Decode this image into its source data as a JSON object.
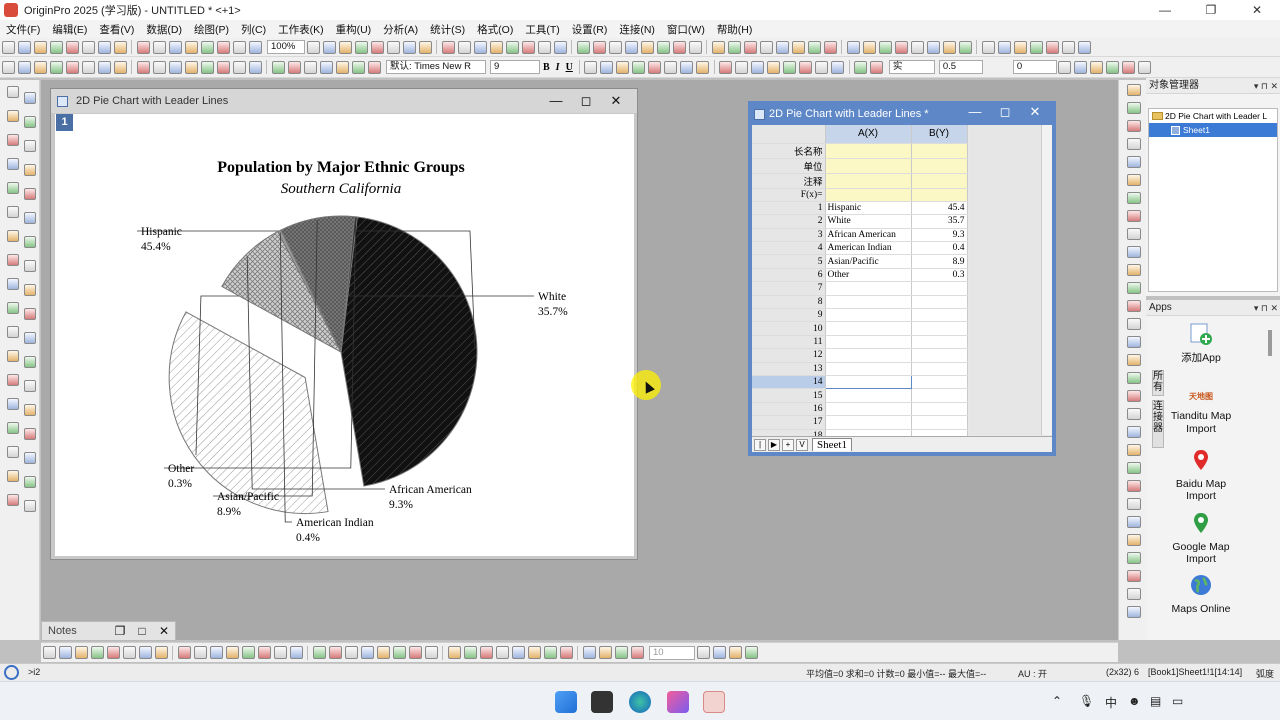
{
  "app": {
    "window_title": "OriginPro 2025 (学习版) - UNTITLED * <+1>",
    "win_buttons": [
      "—",
      "❐",
      "✕"
    ]
  },
  "menu": [
    "文件(F)",
    "编辑(E)",
    "查看(V)",
    "数据(D)",
    "绘图(P)",
    "列(C)",
    "工作表(K)",
    "重构(U)",
    "分析(A)",
    "统计(S)",
    "格式(O)",
    "工具(T)",
    "设置(R)",
    "连接(N)",
    "窗口(W)",
    "帮助(H)"
  ],
  "toolbar": {
    "zoom": "100%",
    "font_name": "默认: Times New R",
    "font_size": "9",
    "bold": "B",
    "italic": "I",
    "underline": "U",
    "line_style": "实",
    "line_width": "0.5",
    "angle": "0",
    "bottom_size": "10"
  },
  "graph_window": {
    "title": "2D Pie Chart with Leader Lines",
    "layer_label": "1"
  },
  "chart_data": {
    "type": "pie",
    "title": "Population by Major Ethnic Groups",
    "subtitle": "Southern California",
    "slices": [
      {
        "label": "Hispanic",
        "value": 45.4,
        "pct_label": "45.4%",
        "fill": "#111111",
        "exploded": false
      },
      {
        "label": "White",
        "value": 35.7,
        "pct_label": "35.7%",
        "fill": "#ffffff",
        "exploded": true
      },
      {
        "label": "African American",
        "value": 9.3,
        "pct_label": "9.3%",
        "fill": "#c8c8c8",
        "exploded": false
      },
      {
        "label": "American Indian",
        "value": 0.4,
        "pct_label": "0.4%",
        "fill": "#9a9a9a",
        "exploded": false
      },
      {
        "label": "Asian/Pacific",
        "value": 8.9,
        "pct_label": "8.9%",
        "fill": "#555555",
        "exploded": false
      },
      {
        "label": "Other",
        "value": 0.3,
        "pct_label": "0.3%",
        "fill": "#333333",
        "exploded": false
      }
    ],
    "leader_lines": true,
    "legend": "none"
  },
  "worksheet": {
    "title": "2D Pie Chart with Leader Lines *",
    "col_headers": [
      "A(X)",
      "B(Y)"
    ],
    "meta_rows": [
      "长名称",
      "单位",
      "注释",
      "F(x)="
    ],
    "rows": [
      {
        "n": "1",
        "a": "Hispanic",
        "b": "45.4"
      },
      {
        "n": "2",
        "a": "White",
        "b": "35.7"
      },
      {
        "n": "3",
        "a": "African American",
        "b": "9.3"
      },
      {
        "n": "4",
        "a": "American Indian",
        "b": "0.4"
      },
      {
        "n": "5",
        "a": "Asian/Pacific",
        "b": "8.9"
      },
      {
        "n": "6",
        "a": "Other",
        "b": "0.3"
      },
      {
        "n": "7",
        "a": "",
        "b": ""
      },
      {
        "n": "8",
        "a": "",
        "b": ""
      },
      {
        "n": "9",
        "a": "",
        "b": ""
      },
      {
        "n": "10",
        "a": "",
        "b": ""
      },
      {
        "n": "11",
        "a": "",
        "b": ""
      },
      {
        "n": "12",
        "a": "",
        "b": ""
      },
      {
        "n": "13",
        "a": "",
        "b": ""
      },
      {
        "n": "14",
        "a": "",
        "b": ""
      },
      {
        "n": "15",
        "a": "",
        "b": ""
      },
      {
        "n": "16",
        "a": "",
        "b": ""
      },
      {
        "n": "17",
        "a": "",
        "b": ""
      },
      {
        "n": "18",
        "a": "",
        "b": ""
      }
    ],
    "sheet_tab": "Sheet1",
    "nav": [
      "|",
      "▶",
      "+",
      "V"
    ]
  },
  "object_manager": {
    "title": "对象管理器",
    "items": [
      "2D Pie Chart with Leader L",
      "Sheet1"
    ]
  },
  "apps_panel": {
    "title": "Apps",
    "side_tabs": [
      "所有",
      "连接器"
    ],
    "apps": [
      {
        "label": "添加App",
        "icon": "add-app-icon"
      },
      {
        "label": "Tianditu Map Import",
        "icon": "tianditu-icon",
        "logo_text": "天地图"
      },
      {
        "label": "Baidu Map Import",
        "icon": "map-pin-icon"
      },
      {
        "label": "Google Map Import",
        "icon": "map-pin-icon"
      },
      {
        "label": "Maps Online",
        "icon": "globe-icon"
      }
    ]
  },
  "notes_panel": {
    "title": "Notes",
    "buttons": [
      "❐",
      "□",
      "✕"
    ]
  },
  "status_bar": {
    "prompt": ">i2",
    "stats": "平均值=0 求和=0 计数=0 最小值=-- 最大值=--",
    "au": "AU : 开",
    "size": "(2x32) 6",
    "location": "[Book1]Sheet1!1[14:14]",
    "unit": "弧度"
  },
  "taskbar": {
    "ime": "中"
  }
}
